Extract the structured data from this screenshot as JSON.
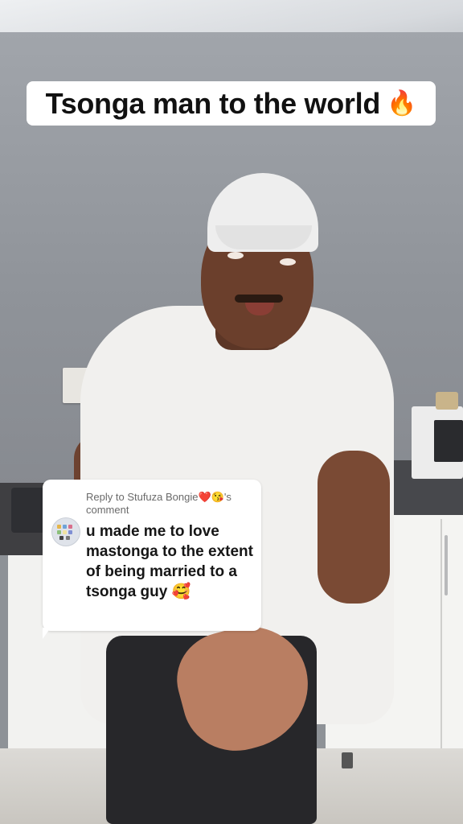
{
  "caption": {
    "text": "Tsonga man to the world",
    "emoji": "🔥"
  },
  "reply": {
    "prefix": "Reply to ",
    "username": "Stufuza Bongie",
    "username_emojis": "❤️😘",
    "suffix": "'s comment",
    "body": "u made me to love mastonga to the extent of being married to a tsonga guy",
    "body_emoji": "🥰"
  }
}
